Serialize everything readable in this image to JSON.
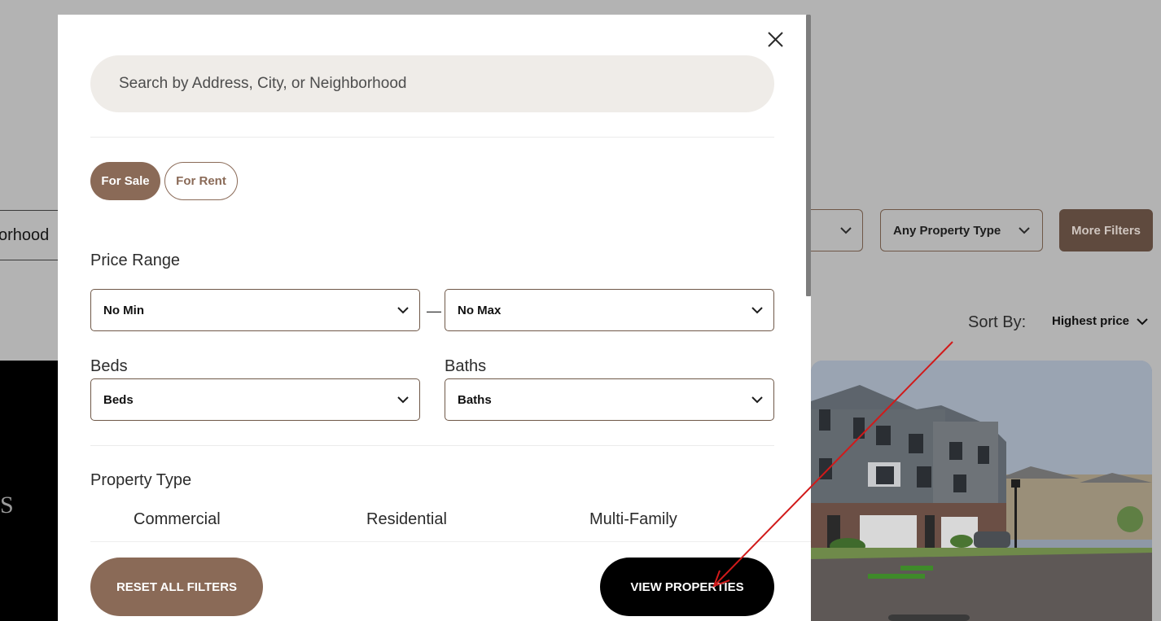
{
  "background": {
    "search_fragment": "orhood",
    "property_type_select": "Any Property Type",
    "more_filters_button": "More Filters",
    "sort_by_label": "Sort By:",
    "sort_by_value": "Highest price",
    "card_logo_fragment": "S"
  },
  "modal": {
    "search": {
      "placeholder": "Search by Address, City, or Neighborhood"
    },
    "listing_type": {
      "options": [
        "For Sale",
        "For Rent"
      ],
      "selected": "For Sale"
    },
    "price_range": {
      "label": "Price Range",
      "min": "No Min",
      "separator": "—",
      "max": "No Max"
    },
    "beds": {
      "label": "Beds",
      "value": "Beds"
    },
    "baths": {
      "label": "Baths",
      "value": "Baths"
    },
    "property_type": {
      "label": "Property Type",
      "options": [
        "Commercial",
        "Residential",
        "Multi-Family"
      ]
    },
    "actions": {
      "reset": "RESET ALL FILTERS",
      "view": "VIEW PROPERTIES"
    }
  },
  "colors": {
    "accent_brown": "#8a6a57",
    "overlay_gray": "#b3b3b3",
    "search_bg": "#efece8",
    "annotation_red": "#d11a1a"
  },
  "icons": [
    "close-icon",
    "chevron-down-icon"
  ]
}
